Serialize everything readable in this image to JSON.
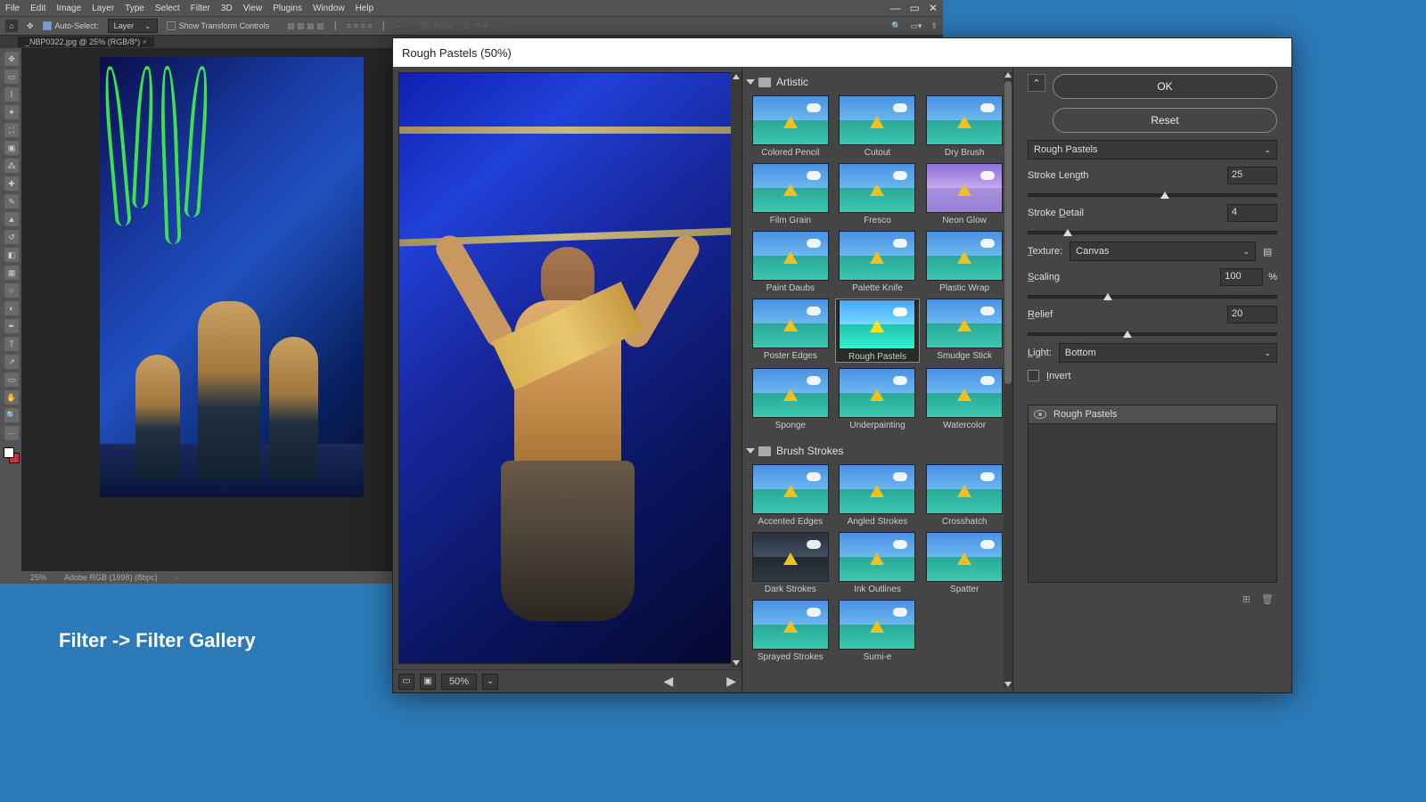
{
  "menubar": [
    "File",
    "Edit",
    "Image",
    "Layer",
    "Type",
    "Select",
    "Filter",
    "3D",
    "View",
    "Plugins",
    "Window",
    "Help"
  ],
  "optbar": {
    "auto_select": "Auto-Select:",
    "layer_dd": "Layer",
    "show_tc": "Show Transform Controls",
    "mode3d": "3D Mode:"
  },
  "doc_tab": "_NBP0322.jpg @ 25% (RGB/8*)",
  "status": {
    "zoom": "25%",
    "profile": "Adobe RGB (1998) (8bpc)"
  },
  "dialog": {
    "title": "Rough Pastels (50%)",
    "ok": "OK",
    "reset": "Reset",
    "filter_dd": "Rough Pastels",
    "params": {
      "stroke_length": {
        "label": "Stroke Length",
        "value": "25"
      },
      "stroke_detail": {
        "label": "Stroke Detail",
        "value": "4"
      },
      "texture_label": "Texture:",
      "texture_value": "Canvas",
      "scaling": {
        "label": "Scaling",
        "value": "100",
        "unit": "%"
      },
      "relief": {
        "label": "Relief",
        "value": "20"
      },
      "light_label": "Light:",
      "light_value": "Bottom",
      "invert": "Invert"
    },
    "zoom": "50%",
    "layer": "Rough Pastels"
  },
  "categories": {
    "artistic": "Artistic",
    "brush": "Brush Strokes"
  },
  "thumbs": {
    "artistic": [
      "Colored Pencil",
      "Cutout",
      "Dry Brush",
      "Film Grain",
      "Fresco",
      "Neon Glow",
      "Paint Daubs",
      "Palette Knife",
      "Plastic Wrap",
      "Poster Edges",
      "Rough Pastels",
      "Smudge Stick",
      "Sponge",
      "Underpainting",
      "Watercolor"
    ],
    "brush": [
      "Accented Edges",
      "Angled Strokes",
      "Crosshatch",
      "Dark Strokes",
      "Ink Outlines",
      "Spatter",
      "Sprayed Strokes",
      "Sumi-e"
    ]
  },
  "caption": "Filter -> Filter Gallery"
}
